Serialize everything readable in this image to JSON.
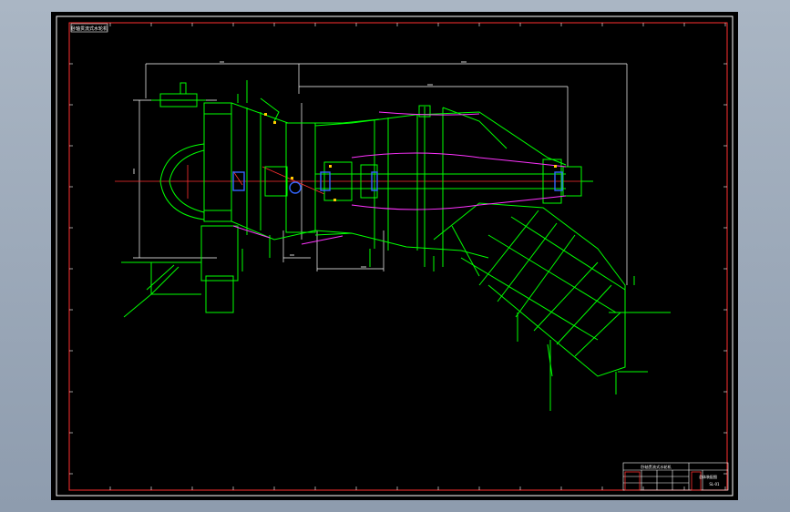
{
  "window": {
    "background_color": "#9aa7b7"
  },
  "drawing": {
    "background_color": "#000000",
    "border_color": "#ff3030",
    "tick_color": "#ffffff",
    "line_colors": {
      "structure": "#00ff00",
      "dimension": "#ffffff",
      "centerline": "#ff3030",
      "blade": "#ff33ff",
      "bearing": "#3366ff",
      "fastener": "#ffcc00"
    },
    "title_label": "卧轴贯流式水轮机",
    "title_block": {
      "title": "卧轴贯流式水轮机",
      "subtitle": "总体装配图",
      "drawing_no": "SL-01"
    }
  }
}
